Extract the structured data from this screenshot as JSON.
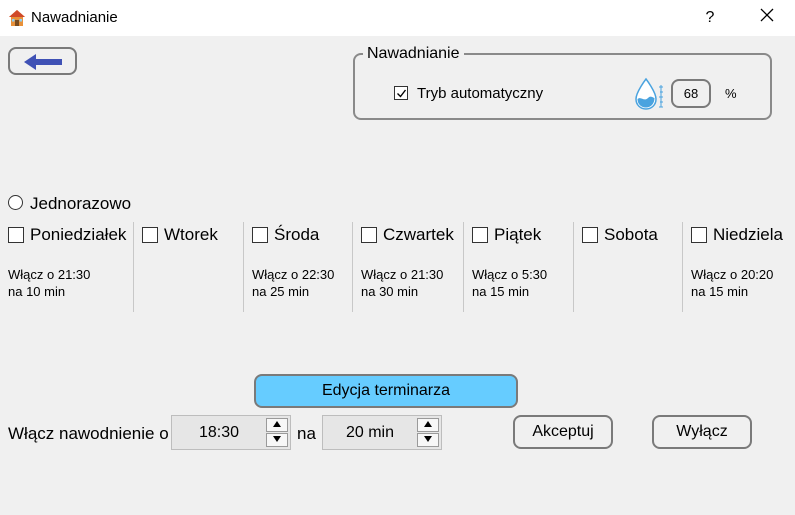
{
  "window": {
    "title": "Nawadnianie",
    "help": "?",
    "icon": "house-icon"
  },
  "toolbar": {
    "back_icon": "arrow-left-icon"
  },
  "group": {
    "legend": "Nawadnianie",
    "auto_label": "Tryb automatyczny",
    "auto_checked": true,
    "humidity_value": "68",
    "humidity_unit": "%",
    "humidity_icon": "water-drop-icon"
  },
  "one_time": {
    "label": "Jednorazowo",
    "selected": false
  },
  "days": [
    {
      "label": "Poniedziałek",
      "checked": false,
      "line1": "Włącz o 21:30",
      "line2": "na 10 min"
    },
    {
      "label": "Wtorek",
      "checked": false,
      "line1": "",
      "line2": ""
    },
    {
      "label": "Środa",
      "checked": false,
      "line1": "Włącz o 22:30",
      "line2": "na 25 min"
    },
    {
      "label": "Czwartek",
      "checked": false,
      "line1": "Włącz o 21:30",
      "line2": "na 30 min"
    },
    {
      "label": "Piątek",
      "checked": false,
      "line1": "Włącz o 5:30",
      "line2": "na 15 min"
    },
    {
      "label": "Sobota",
      "checked": false,
      "line1": "",
      "line2": ""
    },
    {
      "label": "Niedziela",
      "checked": false,
      "line1": "Włącz o 20:20",
      "line2": "na 15 min"
    }
  ],
  "schedule": {
    "edit_label": "Edycja terminarza",
    "on_label": "Włącz nawodnienie o",
    "time_value": "18:30",
    "for_label": "na",
    "duration_value": "20 min",
    "accept_label": "Akceptuj",
    "off_label": "Wyłącz"
  },
  "colors": {
    "accent_button": "#66ccff",
    "arrow": "#3f51b5"
  }
}
